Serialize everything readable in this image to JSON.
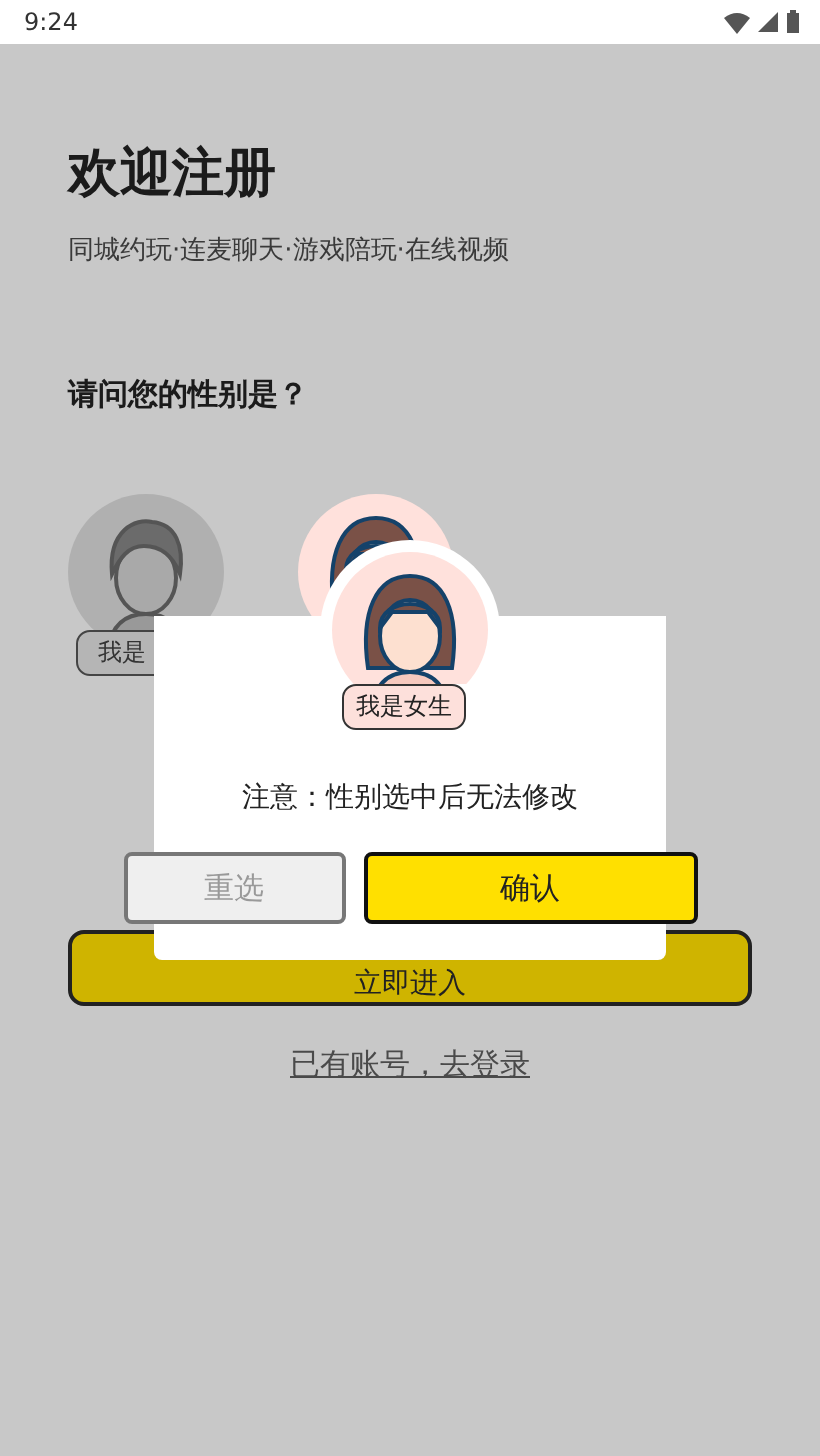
{
  "status_bar": {
    "time": "9:24"
  },
  "header": {
    "title": "欢迎注册",
    "subtitle": "同城约玩·连麦聊天·游戏陪玩·在线视频"
  },
  "question": "请问您的性别是？",
  "genders": [
    {
      "kind": "male",
      "label": "我是",
      "selected": false
    },
    {
      "kind": "female",
      "selected": true
    }
  ],
  "enter_button": "立即进入",
  "login_link": "已有账号，去登录",
  "dialog": {
    "avatar": {
      "kind": "female",
      "label": "我是女生"
    },
    "message": "注意：性别选中后无法修改",
    "buttons": [
      {
        "kind": "secondary",
        "label": "重选"
      },
      {
        "kind": "primary",
        "label": "确认"
      }
    ]
  }
}
